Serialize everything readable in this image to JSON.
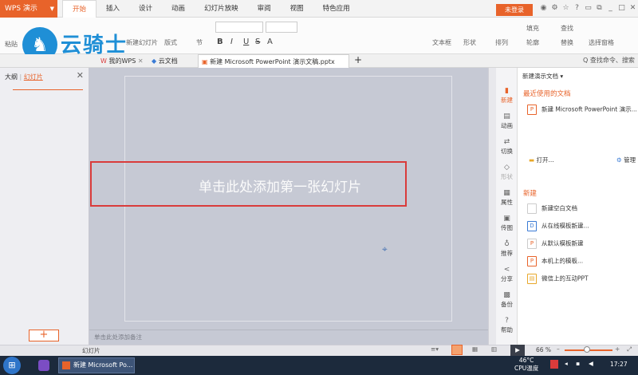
{
  "app": {
    "name": "WPS 演示"
  },
  "menu": [
    "开始",
    "插入",
    "设计",
    "动画",
    "幻灯片放映",
    "审阅",
    "视图",
    "特色应用"
  ],
  "login_label": "未登录",
  "logo_text": "云骑士",
  "ribbon": {
    "paste": "粘贴",
    "new_slide": "新建幻灯片",
    "layout": "版式",
    "section": "节",
    "font_bold": "B",
    "font_italic": "I",
    "font_underline": "U",
    "font_strike": "S",
    "font_color": "A",
    "textbox": "文本框",
    "shape": "形状",
    "arrange": "排列",
    "fill": "填充",
    "outline": "轮廓",
    "find": "查找",
    "replace": "替换",
    "select_pane": "选择窗格"
  },
  "tabs": [
    {
      "label": "我的WPS"
    },
    {
      "label": "云文档"
    },
    {
      "label": "新建 Microsoft PowerPoint 演示文稿.pptx"
    }
  ],
  "search_label": "查找命令、搜索",
  "left_panel": {
    "outline": "大纲",
    "slides": "幻灯片",
    "add": "+"
  },
  "slide": {
    "title_placeholder": "单击此处添加第一张幻灯片"
  },
  "notes_placeholder": "单击此处添加备注",
  "sidebar": [
    "新建",
    "动画",
    "切换",
    "形状",
    "属性",
    "传图",
    "推荐",
    "分享",
    "备份",
    "帮助"
  ],
  "task_pane": {
    "title": "新建演示文档",
    "recent_heading": "最近使用的文档",
    "recent_items": [
      "新建 Microsoft PowerPoint 演示..."
    ],
    "open": "打开...",
    "manage": "管理",
    "new_heading": "新建",
    "new_items": [
      "新建空白文档",
      "从在线模板新建...",
      "从默认模板新建",
      "本机上的模板...",
      "微信上的互动PPT"
    ]
  },
  "status": {
    "mode": "幻灯片",
    "zoom": "66 %"
  },
  "taskbar": {
    "app_label": "新建 Microsoft Po...",
    "temp": "46°C",
    "cpu_label": "CPU温度",
    "time": "17:27"
  },
  "colors": {
    "accent": "#e8632a",
    "canvas": "#c6c9d4",
    "highlight": "#d93b3b"
  }
}
